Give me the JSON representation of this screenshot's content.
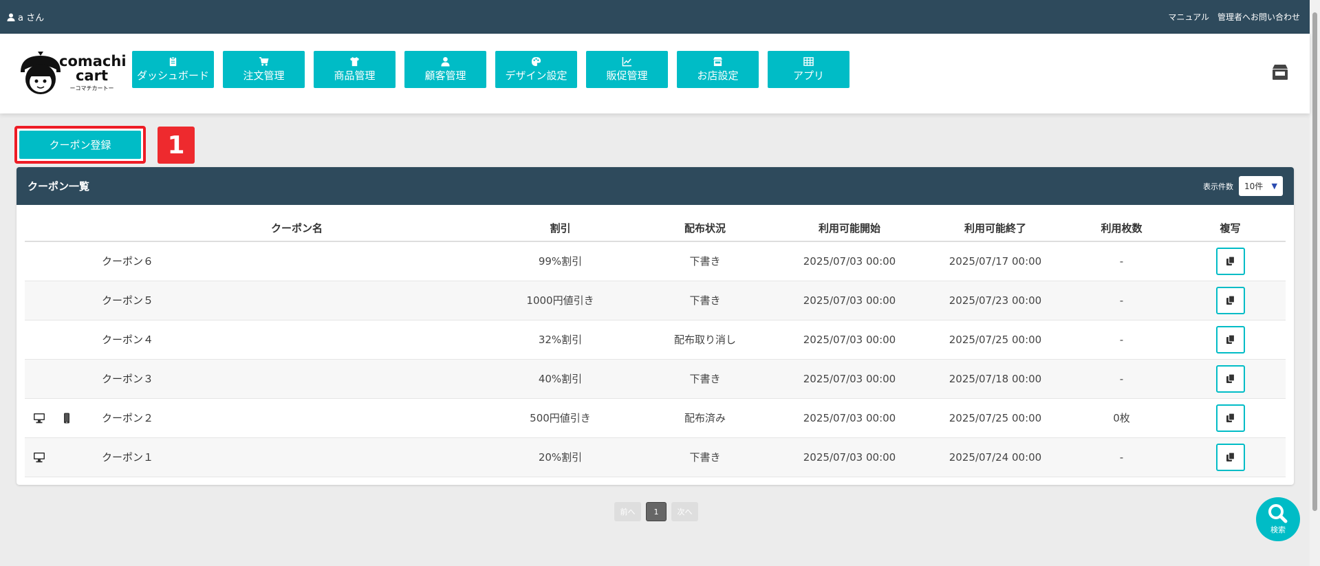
{
  "topbar": {
    "user": "a さん",
    "links": [
      "マニュアル",
      "管理者へお問い合わせ"
    ]
  },
  "logo": {
    "line1": "comachi",
    "line2": "cart",
    "line3": "ーコマチカートー"
  },
  "nav": [
    {
      "label": "ダッシュボード",
      "icon": "clipboard-icon"
    },
    {
      "label": "注文管理",
      "icon": "cart-icon"
    },
    {
      "label": "商品管理",
      "icon": "tshirt-icon"
    },
    {
      "label": "顧客管理",
      "icon": "user-icon"
    },
    {
      "label": "デザイン設定",
      "icon": "palette-icon"
    },
    {
      "label": "販促管理",
      "icon": "chart-icon"
    },
    {
      "label": "お店設定",
      "icon": "store-icon"
    },
    {
      "label": "アプリ",
      "icon": "grid-icon"
    }
  ],
  "register_button": "クーポン登録",
  "step_badge": "1",
  "card": {
    "title": "クーポン一覧",
    "per_page_label": "表示件数",
    "per_page_value": "10件"
  },
  "table": {
    "headers": [
      "クーポン名",
      "割引",
      "配布状況",
      "利用可能開始",
      "利用可能終了",
      "利用枚数",
      "複写"
    ],
    "rows": [
      {
        "pc": false,
        "sp": false,
        "name": "クーポン６",
        "discount": "99%割引",
        "status": "下書き",
        "start": "2025/07/03 00:00",
        "end": "2025/07/17 00:00",
        "used": "-"
      },
      {
        "pc": false,
        "sp": false,
        "name": "クーポン５",
        "discount": "1000円値引き",
        "status": "下書き",
        "start": "2025/07/03 00:00",
        "end": "2025/07/23 00:00",
        "used": "-"
      },
      {
        "pc": false,
        "sp": false,
        "name": "クーポン４",
        "discount": "32%割引",
        "status": "配布取り消し",
        "start": "2025/07/03 00:00",
        "end": "2025/07/25 00:00",
        "used": "-"
      },
      {
        "pc": false,
        "sp": false,
        "name": "クーポン３",
        "discount": "40%割引",
        "status": "下書き",
        "start": "2025/07/03 00:00",
        "end": "2025/07/18 00:00",
        "used": "-"
      },
      {
        "pc": true,
        "sp": true,
        "name": "クーポン２",
        "discount": "500円値引き",
        "status": "配布済み",
        "start": "2025/07/03 00:00",
        "end": "2025/07/25 00:00",
        "used": "0枚"
      },
      {
        "pc": true,
        "sp": false,
        "name": "クーポン１",
        "discount": "20%割引",
        "status": "下書き",
        "start": "2025/07/03 00:00",
        "end": "2025/07/24 00:00",
        "used": "-"
      }
    ]
  },
  "pagination": {
    "prev": "前へ",
    "current": "1",
    "next": "次へ"
  },
  "fab": {
    "label": "検索",
    "icon": "search-icon"
  },
  "colors": {
    "navy": "#2e4a5c",
    "teal": "#00bcc6",
    "highlight_red": "#ee1c25"
  }
}
